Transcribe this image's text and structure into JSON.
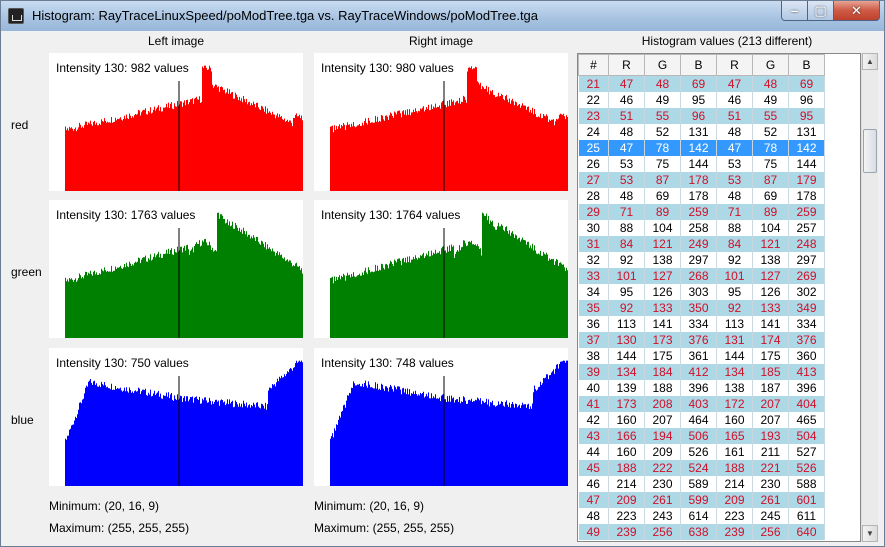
{
  "window": {
    "title": "Histogram: RayTraceLinuxSpeed/poModTree.tga vs.  RayTraceWindows/poModTree.tga",
    "minimize_glyph": "–",
    "maximize_glyph": "▢",
    "close_glyph": "✕"
  },
  "columns": {
    "left": "Left image",
    "right": "Right image"
  },
  "rows": {
    "red": "red",
    "green": "green",
    "blue": "blue"
  },
  "colors": {
    "red": "#ff0000",
    "green": "#008000",
    "blue": "#0000ff",
    "row_highlight": "#add8e6",
    "row_text_alt": "#d0102a",
    "selected": "#3399ff"
  },
  "histograms": {
    "left": {
      "red": "Intensity 130: 982 values",
      "green": "Intensity 130: 1763 values",
      "blue": "Intensity 130: 750 values"
    },
    "right": {
      "red": "Intensity 130: 980 values",
      "green": "Intensity 130: 1764 values",
      "blue": "Intensity 130: 748 values"
    }
  },
  "stats": {
    "left": {
      "min": "Minimum: (20, 16, 9)",
      "max": "Maximum: (255, 255, 255)"
    },
    "right": {
      "min": "Minimum: (20, 16, 9)",
      "max": "Maximum: (255, 255, 255)"
    }
  },
  "table": {
    "title": "Histogram values (213 different)",
    "headers": [
      "#",
      "R",
      "G",
      "B",
      "R",
      "G",
      "B"
    ],
    "selected_index": 25,
    "rows": [
      [
        21,
        47,
        48,
        69,
        47,
        48,
        69
      ],
      [
        22,
        46,
        49,
        95,
        46,
        49,
        96
      ],
      [
        23,
        51,
        55,
        96,
        51,
        55,
        95
      ],
      [
        24,
        48,
        52,
        131,
        48,
        52,
        131
      ],
      [
        25,
        47,
        78,
        142,
        47,
        78,
        142
      ],
      [
        26,
        53,
        75,
        144,
        53,
        75,
        144
      ],
      [
        27,
        53,
        87,
        178,
        53,
        87,
        179
      ],
      [
        28,
        48,
        69,
        178,
        48,
        69,
        178
      ],
      [
        29,
        71,
        89,
        259,
        71,
        89,
        259
      ],
      [
        30,
        88,
        104,
        258,
        88,
        104,
        257
      ],
      [
        31,
        84,
        121,
        249,
        84,
        121,
        248
      ],
      [
        32,
        92,
        138,
        297,
        92,
        138,
        297
      ],
      [
        33,
        101,
        127,
        268,
        101,
        127,
        269
      ],
      [
        34,
        95,
        126,
        303,
        95,
        126,
        302
      ],
      [
        35,
        92,
        133,
        350,
        92,
        133,
        349
      ],
      [
        36,
        113,
        141,
        334,
        113,
        141,
        334
      ],
      [
        37,
        130,
        173,
        376,
        131,
        174,
        376
      ],
      [
        38,
        144,
        175,
        361,
        144,
        175,
        360
      ],
      [
        39,
        134,
        184,
        412,
        134,
        185,
        413
      ],
      [
        40,
        139,
        188,
        396,
        138,
        187,
        396
      ],
      [
        41,
        173,
        208,
        403,
        172,
        207,
        404
      ],
      [
        42,
        160,
        207,
        464,
        160,
        207,
        465
      ],
      [
        43,
        166,
        194,
        506,
        165,
        193,
        504
      ],
      [
        44,
        160,
        209,
        526,
        161,
        211,
        527
      ],
      [
        45,
        188,
        222,
        524,
        188,
        221,
        526
      ],
      [
        46,
        214,
        230,
        589,
        214,
        230,
        588
      ],
      [
        47,
        209,
        261,
        599,
        209,
        261,
        601
      ],
      [
        48,
        223,
        243,
        614,
        223,
        245,
        611
      ],
      [
        49,
        239,
        256,
        638,
        239,
        256,
        640
      ]
    ]
  }
}
